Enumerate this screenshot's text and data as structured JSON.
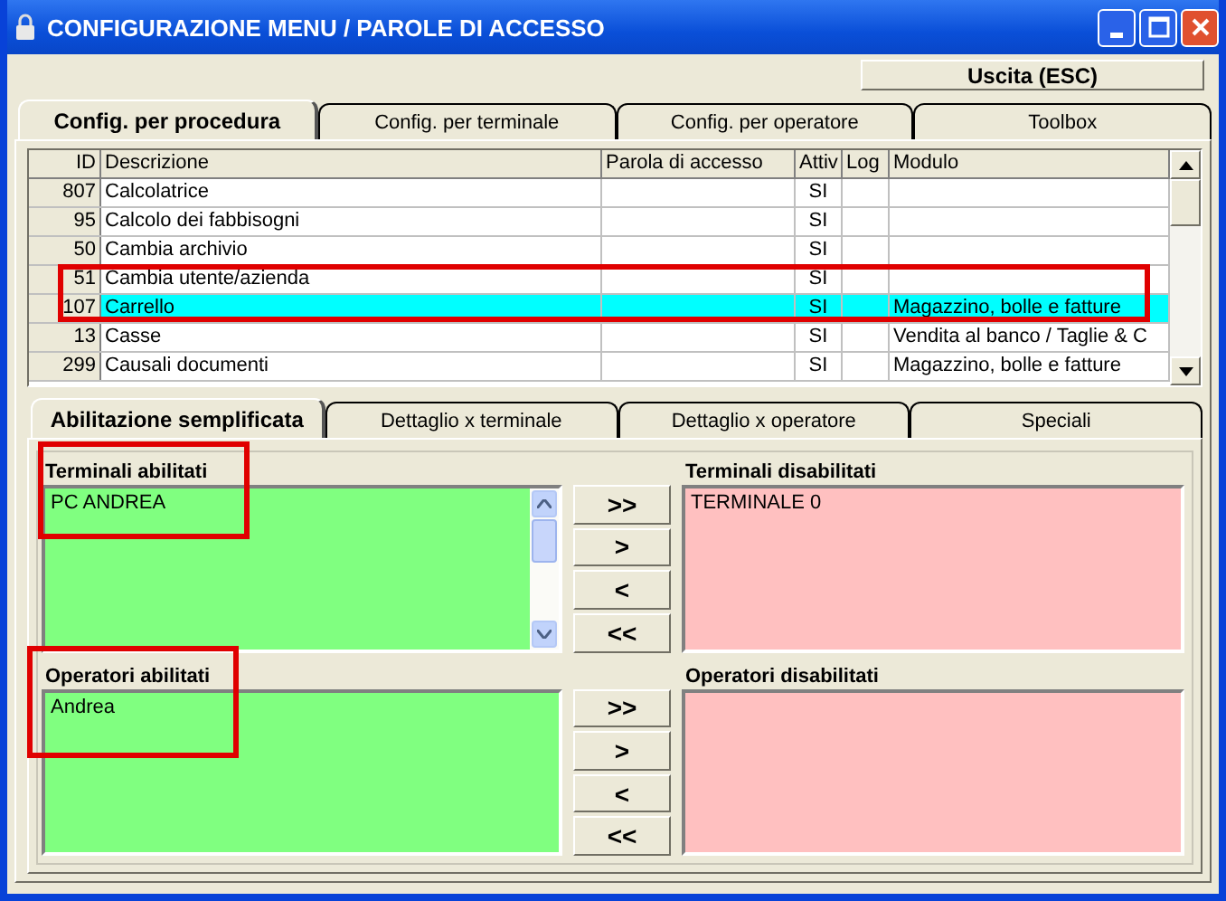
{
  "window": {
    "title": "CONFIGURAZIONE MENU / PAROLE DI ACCESSO"
  },
  "exit_button": "Uscita (ESC)",
  "tabs": [
    {
      "label": "Config. per procedura",
      "selected": true
    },
    {
      "label": "Config. per terminale",
      "selected": false
    },
    {
      "label": "Config. per operatore",
      "selected": false
    },
    {
      "label": "Toolbox",
      "selected": false
    }
  ],
  "table": {
    "columns": [
      "ID",
      "Descrizione",
      "Parola di accesso",
      "Attiv",
      "Log",
      "Modulo"
    ],
    "rows": [
      {
        "cells": [
          "807",
          "Calcolatrice",
          "",
          "SI",
          "",
          ""
        ],
        "selected": false
      },
      {
        "cells": [
          "95",
          "Calcolo dei fabbisogni",
          "",
          "SI",
          "",
          ""
        ],
        "selected": false
      },
      {
        "cells": [
          "50",
          "Cambia archivio",
          "",
          "SI",
          "",
          ""
        ],
        "selected": false
      },
      {
        "cells": [
          "51",
          "Cambia utente/azienda",
          "",
          "SI",
          "",
          ""
        ],
        "selected": false
      },
      {
        "cells": [
          "107",
          "Carrello",
          "",
          "SI",
          "",
          "Magazzino, bolle e fatture"
        ],
        "selected": true
      },
      {
        "cells": [
          "13",
          "Casse",
          "",
          "SI",
          "",
          "Vendita al banco / Taglie & C"
        ],
        "selected": false
      },
      {
        "cells": [
          "299",
          "Causali documenti",
          "",
          "SI",
          "",
          "Magazzino, bolle e fatture"
        ],
        "selected": false
      }
    ]
  },
  "sub_tabs": [
    {
      "label": "Abilitazione semplificata",
      "selected": true
    },
    {
      "label": "Dettaglio x terminale",
      "selected": false
    },
    {
      "label": "Dettaglio x operatore",
      "selected": false
    },
    {
      "label": "Speciali",
      "selected": false
    }
  ],
  "groups": [
    {
      "enabled_label": "Terminali abilitati",
      "enabled_items": [
        "PC ANDREA"
      ],
      "disabled_label": "Terminali disabilitati",
      "disabled_items": [
        "TERMINALE 0"
      ],
      "scrollbar": true,
      "buttons": [
        ">>",
        ">",
        "<",
        "<<"
      ]
    },
    {
      "enabled_label": "Operatori abilitati",
      "enabled_items": [
        "Andrea"
      ],
      "disabled_label": "Operatori disabilitati",
      "scrollbar": false,
      "buttons": [
        ">>",
        ">",
        "<",
        "<<"
      ]
    }
  ]
}
